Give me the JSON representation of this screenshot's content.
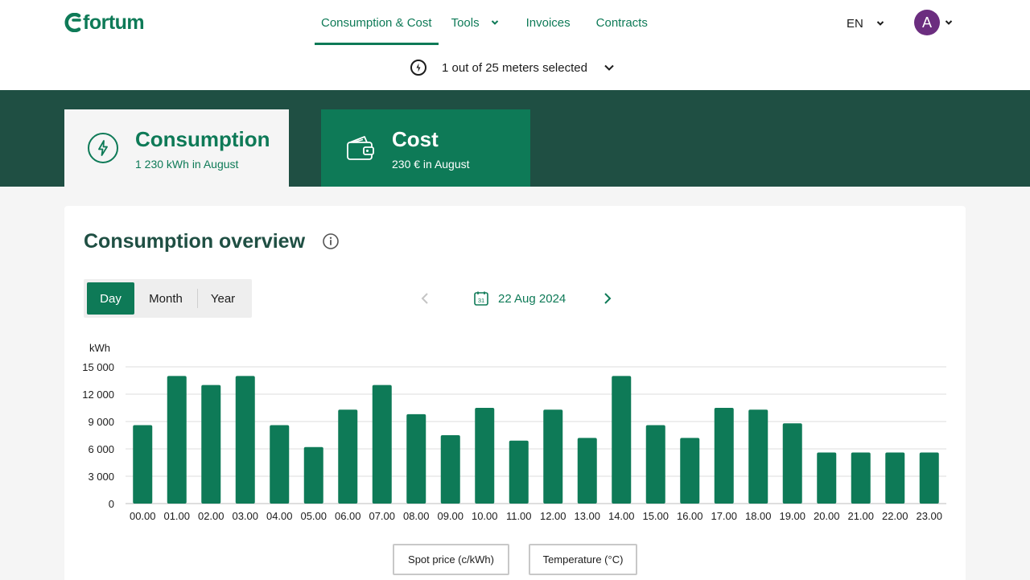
{
  "brand": {
    "name": "fortum",
    "color": "#0e7a57"
  },
  "nav": {
    "items": [
      {
        "label": "Consumption & Cost",
        "active": true
      },
      {
        "label": "Tools",
        "has_dropdown": true
      },
      {
        "label": "Invoices"
      },
      {
        "label": "Contracts"
      }
    ]
  },
  "language": {
    "label": "EN"
  },
  "user": {
    "initial": "A",
    "avatar_color": "#6b2d7f"
  },
  "meters": {
    "label": "1 out of 25 meters selected",
    "icon": "meter-icon"
  },
  "tabs": {
    "consumption": {
      "title": "Consumption",
      "subtitle": "1 230 kWh in August",
      "icon": "lightning-icon"
    },
    "cost": {
      "title": "Cost",
      "subtitle": "230 € in August",
      "icon": "wallet-icon"
    }
  },
  "overview": {
    "title": "Consumption overview",
    "periods": [
      "Day",
      "Month",
      "Year"
    ],
    "active_period": "Day",
    "date": "22 Aug 2024",
    "calendar_day": "31"
  },
  "chart_data": {
    "type": "bar",
    "ylabel": "kWh",
    "ylim": [
      0,
      15000
    ],
    "yticks": [
      0,
      3000,
      6000,
      9000,
      12000,
      15000
    ],
    "ytick_labels": [
      "0",
      "3 000",
      "6 000",
      "9 000",
      "12 000",
      "15 000"
    ],
    "categories": [
      "00.00",
      "01.00",
      "02.00",
      "03.00",
      "04.00",
      "05.00",
      "06.00",
      "07.00",
      "08.00",
      "09.00",
      "10.00",
      "11.00",
      "12.00",
      "13.00",
      "14.00",
      "15.00",
      "16.00",
      "17.00",
      "18.00",
      "19.00",
      "20.00",
      "21.00",
      "22.00",
      "23.00"
    ],
    "values": [
      8600,
      14000,
      13000,
      14000,
      8600,
      6200,
      10300,
      13000,
      9800,
      7500,
      10500,
      6900,
      10300,
      7200,
      14000,
      8600,
      7200,
      10500,
      10300,
      8800,
      5600,
      5600,
      5600,
      5600
    ],
    "bar_color": "#0e7a57",
    "grid": true
  },
  "toggles": [
    {
      "label": "Spot price (c/kWh)"
    },
    {
      "label": "Temperature (°C)"
    }
  ]
}
